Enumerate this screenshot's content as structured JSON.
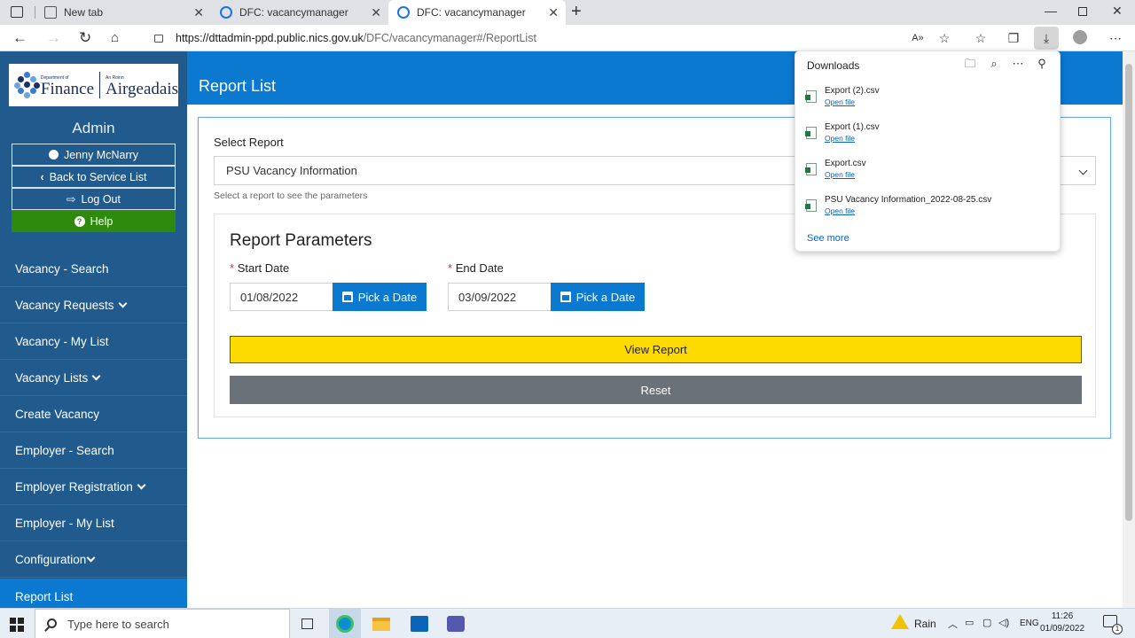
{
  "browser": {
    "tabs": [
      {
        "title": "New tab",
        "active": false
      },
      {
        "title": "DFC: vacancymanager",
        "active": false
      },
      {
        "title": "DFC: vacancymanager",
        "active": true
      }
    ],
    "url_host": "https://dttadmin-ppd.public.nics.gov.uk",
    "url_path": "/DFC/vacancymanager#/ReportList"
  },
  "sidebar": {
    "logo_small_left": "Department of",
    "logo_big_left": "Finance",
    "logo_small_right": "An Roinn",
    "logo_big_right": "Airgeadais",
    "admin_title": "Admin",
    "user_name": "Jenny McNarry",
    "back_label": "Back to Service List",
    "logout_label": "Log Out",
    "help_label": "Help",
    "nav": [
      {
        "label": "Vacancy - Search",
        "has_chevron": false
      },
      {
        "label": "Vacancy Requests",
        "has_chevron": true
      },
      {
        "label": "Vacancy - My List",
        "has_chevron": false
      },
      {
        "label": "Vacancy Lists",
        "has_chevron": true
      },
      {
        "label": "Create Vacancy",
        "has_chevron": false
      },
      {
        "label": "Employer - Search",
        "has_chevron": false
      },
      {
        "label": "Employer Registration",
        "has_chevron": true
      },
      {
        "label": "Employer - My List",
        "has_chevron": false
      },
      {
        "label": "Configuration",
        "has_chevron": true
      },
      {
        "label": "Report List",
        "has_chevron": false,
        "active": true
      }
    ]
  },
  "main": {
    "page_title": "Report List",
    "select_label": "Select Report",
    "select_value": "PSU Vacancy Information",
    "select_help": "Select a report to see the parameters",
    "params_title": "Report Parameters",
    "start_label": "Start Date",
    "start_value": "01/08/2022",
    "end_label": "End Date",
    "end_value": "03/09/2022",
    "pick_label": "Pick a Date",
    "view_label": "View Report",
    "reset_label": "Reset",
    "required_mark": "*"
  },
  "downloads": {
    "title": "Downloads",
    "items": [
      {
        "name": "Export (2).csv",
        "action": "Open file"
      },
      {
        "name": "Export (1).csv",
        "action": "Open file"
      },
      {
        "name": "Export.csv",
        "action": "Open file"
      },
      {
        "name": "PSU Vacancy Information_2022-08-25.csv",
        "action": "Open file"
      }
    ],
    "see_more": "See more"
  },
  "taskbar": {
    "search_placeholder": "Type here to search",
    "weather": "Rain",
    "language": "ENG",
    "time": "11:26",
    "date": "01/09/2022",
    "notification_count": "1"
  },
  "colors": {
    "sidebar": "#215a8c",
    "header": "#0b79d0",
    "help_button": "#2e8a0c",
    "view_button": "#fedb00",
    "reset_button": "#6b7178"
  }
}
